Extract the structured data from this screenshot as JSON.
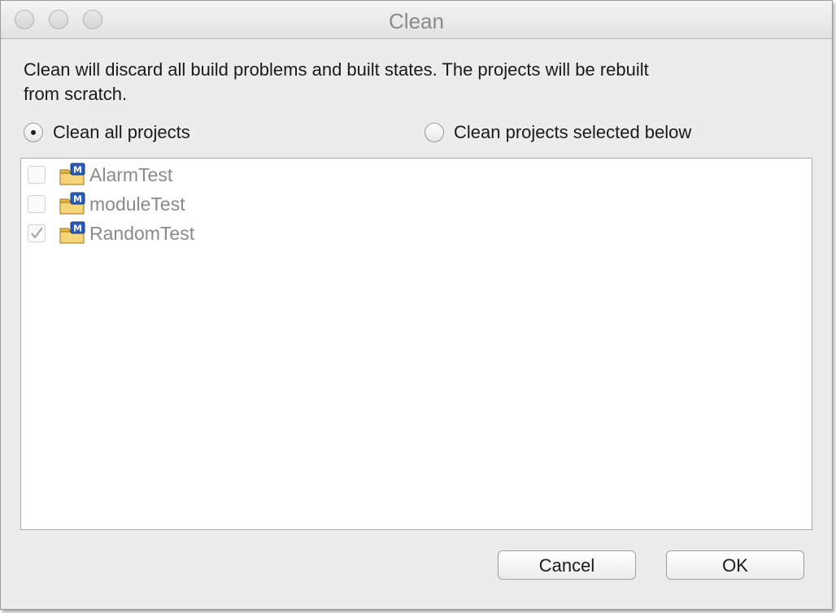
{
  "window": {
    "title": "Clean"
  },
  "dialog": {
    "description_line1": "Clean will discard all build problems and built states.  The projects will be rebuilt",
    "description_line2": "from scratch.",
    "radio_all_label": "Clean all projects",
    "radio_selected_label": "Clean projects selected below",
    "selected_option": "Clean all projects"
  },
  "projects": [
    {
      "name": "AlarmTest",
      "checked": false,
      "icon": "project-folder-icon"
    },
    {
      "name": "moduleTest",
      "checked": false,
      "icon": "project-folder-icon"
    },
    {
      "name": "RandomTest",
      "checked": true,
      "icon": "project-folder-icon"
    }
  ],
  "buttons": {
    "cancel_label": "Cancel",
    "ok_label": "OK"
  }
}
